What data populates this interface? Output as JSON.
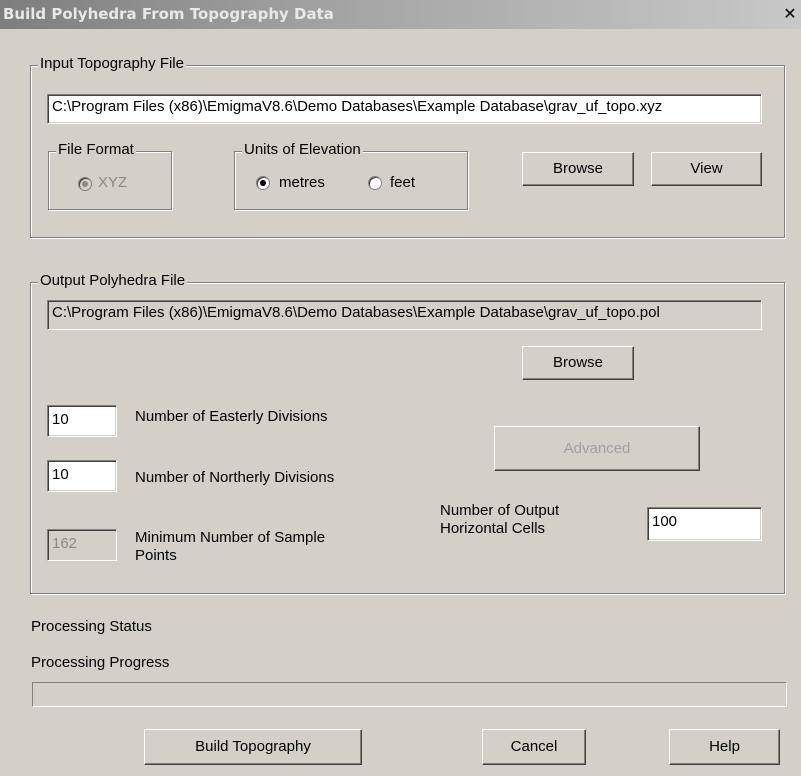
{
  "window": {
    "title": "Build Polyhedra From Topography Data",
    "close_glyph": "✕"
  },
  "input_group": {
    "legend": "Input Topography File",
    "file_path": "C:\\Program Files (x86)\\EmigmaV8.6\\Demo Databases\\Example Database\\grav_uf_topo.xyz",
    "file_format": {
      "legend": "File Format",
      "option_label": "XYZ"
    },
    "units": {
      "legend": "Units of Elevation",
      "metres_label": "metres",
      "feet_label": "feet",
      "selected": "metres"
    },
    "browse_label": "Browse",
    "view_label": "View"
  },
  "output_group": {
    "legend": "Output Polyhedra File",
    "file_path": "C:\\Program Files (x86)\\EmigmaV8.6\\Demo Databases\\Example Database\\grav_uf_topo.pol",
    "browse_label": "Browse",
    "easterly": {
      "value": "10",
      "label": "Number of Easterly Divisions"
    },
    "northerly": {
      "value": "10",
      "label": "Number of Northerly Divisions"
    },
    "min_samples": {
      "value": "162",
      "label_line1": "Minimum Number of Sample",
      "label_line2": "Points"
    },
    "advanced_label": "Advanced",
    "horizontal_cells": {
      "label_line1": "Number of Output",
      "label_line2": "Horizontal Cells",
      "value": "100"
    }
  },
  "status": {
    "processing_status_label": "Processing Status",
    "processing_progress_label": "Processing Progress"
  },
  "footer": {
    "build_label": "Build Topography",
    "cancel_label": "Cancel",
    "help_label": "Help"
  }
}
